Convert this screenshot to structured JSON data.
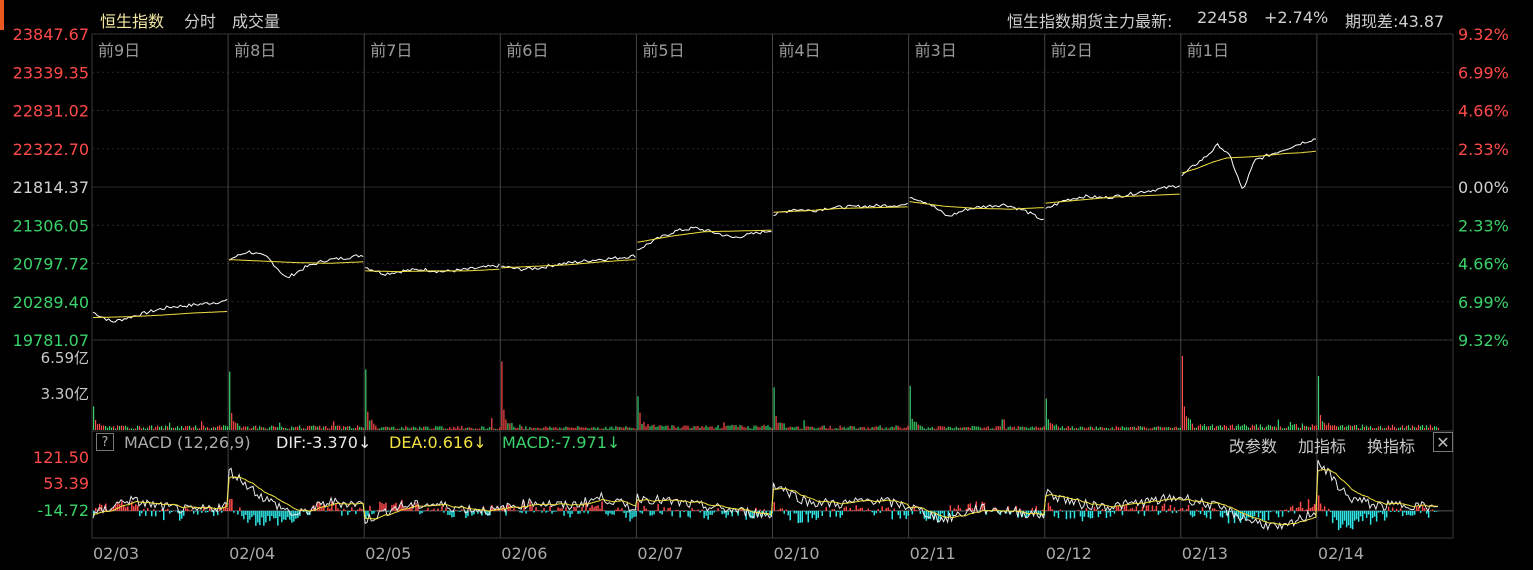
{
  "tabs": {
    "index_name": "恒生指数",
    "intraday": "分时",
    "volume": "成交量"
  },
  "futures": {
    "label": "恒生指数期货主力最新:",
    "price": "22458",
    "change": "+2.74%",
    "basis_label": "期现差:43.87"
  },
  "macd": {
    "help": "?",
    "title": "MACD (12,26,9)",
    "dif": "DIF:-3.370↓",
    "dea": "DEA:0.616↓",
    "macd": "MACD:-7.971↓",
    "modify": "改参数",
    "add": "加指标",
    "switch": "换指标",
    "close": "✕"
  },
  "colors": {
    "up": "#ff4a4a",
    "down": "#3ad26a",
    "price_line": "#ffffff",
    "avg_line": "#f0e040",
    "grid": "#3a3a3a",
    "macd_neg": "#2ee6e6"
  },
  "chart_data": {
    "type": "line",
    "day_labels": [
      "前9日",
      "前8日",
      "前7日",
      "前6日",
      "前5日",
      "前4日",
      "前3日",
      "前2日",
      "前1日",
      ""
    ],
    "dates": [
      "02/03",
      "02/04",
      "02/05",
      "02/06",
      "02/07",
      "02/10",
      "02/11",
      "02/12",
      "02/13",
      "02/14"
    ],
    "price_axis": {
      "ticks": [
        "23847.67",
        "23339.35",
        "22831.02",
        "22322.70",
        "21814.37",
        "21306.05",
        "20797.72",
        "20289.40",
        "19781.07"
      ],
      "ylim": [
        19781.07,
        23847.67
      ],
      "prev_close": 21814.37
    },
    "pct_axis": {
      "ticks": [
        "9.32%",
        "6.99%",
        "4.66%",
        "2.33%",
        "0.00%",
        "2.33%",
        "4.66%",
        "6.99%",
        "9.32%"
      ]
    },
    "volume_axis": {
      "ticks": [
        "6.59亿",
        "3.30亿"
      ],
      "max": 6.59
    },
    "macd_axis": {
      "ticks": [
        "121.50",
        "53.39",
        "-14.72"
      ]
    },
    "series": [
      {
        "name": "price",
        "days": [
          [
            20150,
            20020,
            20090,
            20160,
            20220,
            20240,
            20270,
            20300
          ],
          [
            20850,
            20960,
            20880,
            20600,
            20750,
            20840,
            20870,
            20910
          ],
          [
            20750,
            20660,
            20700,
            20720,
            20690,
            20710,
            20740,
            20770
          ],
          [
            20760,
            20720,
            20740,
            20790,
            20820,
            20850,
            20870,
            20900
          ],
          [
            20980,
            21120,
            21230,
            21270,
            21210,
            21140,
            21190,
            21240
          ],
          [
            21440,
            21520,
            21500,
            21540,
            21550,
            21560,
            21570,
            21580
          ],
          [
            21690,
            21600,
            21420,
            21520,
            21560,
            21580,
            21500,
            21370
          ],
          [
            21520,
            21640,
            21690,
            21670,
            21700,
            21750,
            21790,
            21840
          ],
          [
            21960,
            22100,
            22220,
            22380,
            22210,
            21760,
            22170,
            22230,
            22290,
            22350,
            22410,
            22458
          ]
        ]
      },
      {
        "name": "avg",
        "days": [
          [
            20080,
            20090,
            20110,
            20140,
            20160
          ],
          [
            20850,
            20830,
            20810,
            20800,
            20820
          ],
          [
            20700,
            20690,
            20700,
            20700,
            20720
          ],
          [
            20740,
            20760,
            20780,
            20820,
            20850
          ],
          [
            21080,
            21160,
            21220,
            21230,
            21240
          ],
          [
            21480,
            21500,
            21530,
            21540,
            21550
          ],
          [
            21620,
            21560,
            21530,
            21520,
            21540
          ],
          [
            21600,
            21640,
            21680,
            21700,
            21720
          ],
          [
            22000,
            22060,
            22140,
            22200,
            22210,
            22220,
            22240,
            22260,
            22270,
            22290
          ]
        ]
      },
      {
        "name": "volume",
        "opens": [
          2.1,
          5.2,
          5.4,
          6.1,
          3.0,
          3.8,
          3.4,
          2.8,
          6.59,
          4.8
        ],
        "base": [
          0.35,
          0.35,
          0.3,
          0.3,
          0.4,
          0.35,
          0.3,
          0.3,
          0.45,
          0.4
        ]
      },
      {
        "name": "macd",
        "day_trend": [
          [
            -10,
            25,
            10,
            0,
            12
          ],
          [
            90,
            30,
            -10,
            20,
            15
          ],
          [
            -20,
            10,
            15,
            5,
            0
          ],
          [
            5,
            20,
            10,
            30,
            5
          ],
          [
            30,
            20,
            10,
            0,
            -10
          ],
          [
            60,
            20,
            15,
            25,
            10
          ],
          [
            10,
            -20,
            5,
            0,
            -10
          ],
          [
            40,
            15,
            10,
            20,
            30
          ],
          [
            30,
            10,
            -20,
            -40,
            0
          ],
          [
            110,
            30,
            10,
            15,
            5
          ]
        ]
      }
    ]
  }
}
